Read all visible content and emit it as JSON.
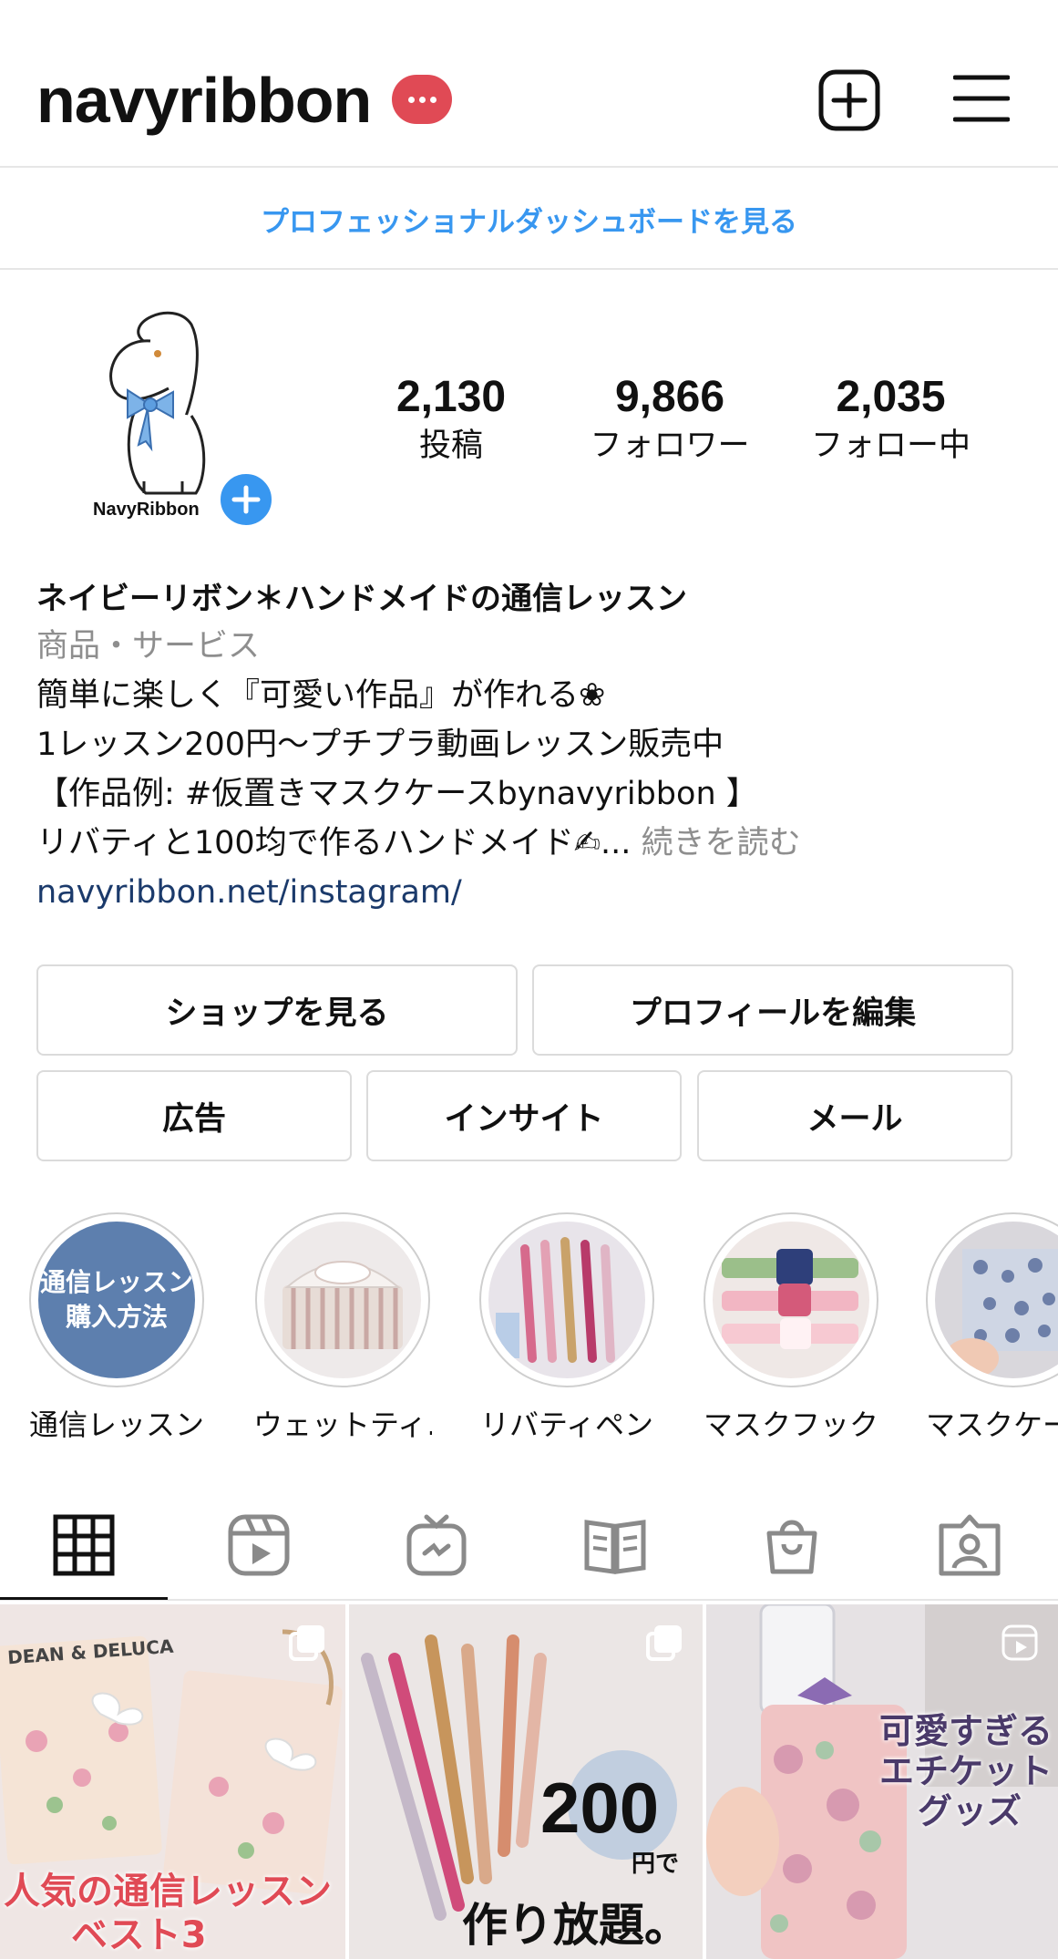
{
  "header": {
    "username": "navyribbon",
    "notification_icon": "more-dots-icon",
    "new_post_icon": "plus-square-icon",
    "menu_icon": "hamburger-menu-icon"
  },
  "dashboard_link": "プロフェッショナルダッシュボードを見る",
  "profile": {
    "avatar_text": "NavyRibbon",
    "stats": [
      {
        "value": "2,130",
        "label": "投稿"
      },
      {
        "value": "9,866",
        "label": "フォロワー"
      },
      {
        "value": "2,035",
        "label": "フォロー中"
      }
    ]
  },
  "bio": {
    "name": "ネイビーリボン＊ハンドメイドの通信レッスン",
    "category": "商品・サービス",
    "lines": [
      "簡単に楽しく『可愛い作品』が作れる❀",
      "1レッスン200円〜プチプラ動画レッスン販売中",
      "【作品例: #仮置きマスクケースbynavyribbon 】",
      "リバティと100均で作るハンドメイド✍..."
    ],
    "more": "続きを読む",
    "link": "navyribbon.net/instagram/"
  },
  "buttons": {
    "shop": "ショップを見る",
    "edit": "プロフィールを編集",
    "ad": "広告",
    "insight": "インサイト",
    "mail": "メール"
  },
  "highlights": [
    {
      "label": "通信レッスン",
      "cover_text_1": "通信レッスン",
      "cover_text_2": "購入方法"
    },
    {
      "label": "ウェットティ…"
    },
    {
      "label": "リバティペン"
    },
    {
      "label": "マスクフック"
    },
    {
      "label": "マスクケー"
    }
  ],
  "tabs": [
    "grid-icon",
    "reels-icon",
    "igtv-icon",
    "guides-icon",
    "shop-icon",
    "tagged-icon"
  ],
  "posts": [
    {
      "overlay_1": "人気の通信レッスン",
      "overlay_2": "ベスト3",
      "brand": "DEAN & DELUCA"
    },
    {
      "overlay_num": "200",
      "overlay_unit": "円で",
      "overlay_main": "作り放題。"
    },
    {
      "overlay_1": "可愛すぎる",
      "overlay_2": "エチケット",
      "overlay_3": "グッズ"
    }
  ],
  "colors": {
    "accent_blue": "#3897f0",
    "badge_red": "#e04a55",
    "link_navy": "#1b3a6b",
    "muted_gray": "#8e8e8e"
  }
}
